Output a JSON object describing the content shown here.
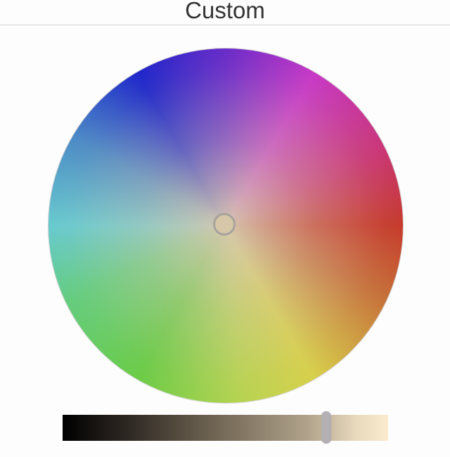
{
  "header": {
    "title": "Custom"
  },
  "color_wheel": {
    "selected_color": "#d6c7a9",
    "handle_icon": "circle-handle"
  },
  "brightness_slider": {
    "value": 0.81,
    "gradient_start": "#000000",
    "gradient_end": "#faebce"
  }
}
